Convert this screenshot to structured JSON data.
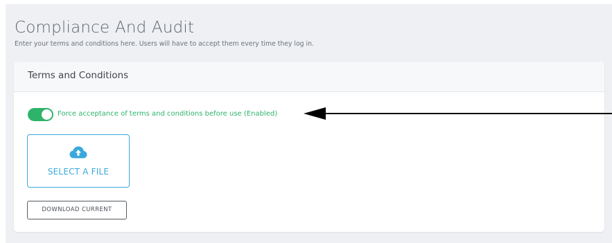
{
  "page": {
    "title": "Compliance And Audit",
    "subtitle": "Enter your terms and conditions here. Users will have to accept them every time they log in."
  },
  "card": {
    "title": "Terms and Conditions",
    "toggle": {
      "state": "on",
      "label": "Force acceptance of terms and conditions before use (Enabled)"
    },
    "select_file": {
      "icon": "cloud-upload-icon",
      "label": "SELECT A FILE"
    },
    "download_button": {
      "label": "DOWNLOAD CURRENT"
    }
  },
  "annotation": {
    "icon": "arrow-left-icon"
  },
  "colors": {
    "background": "#eef0f3",
    "toggle_on": "#2fb36b",
    "accent_blue": "#3aa8dc",
    "title_text": "#60656d"
  }
}
